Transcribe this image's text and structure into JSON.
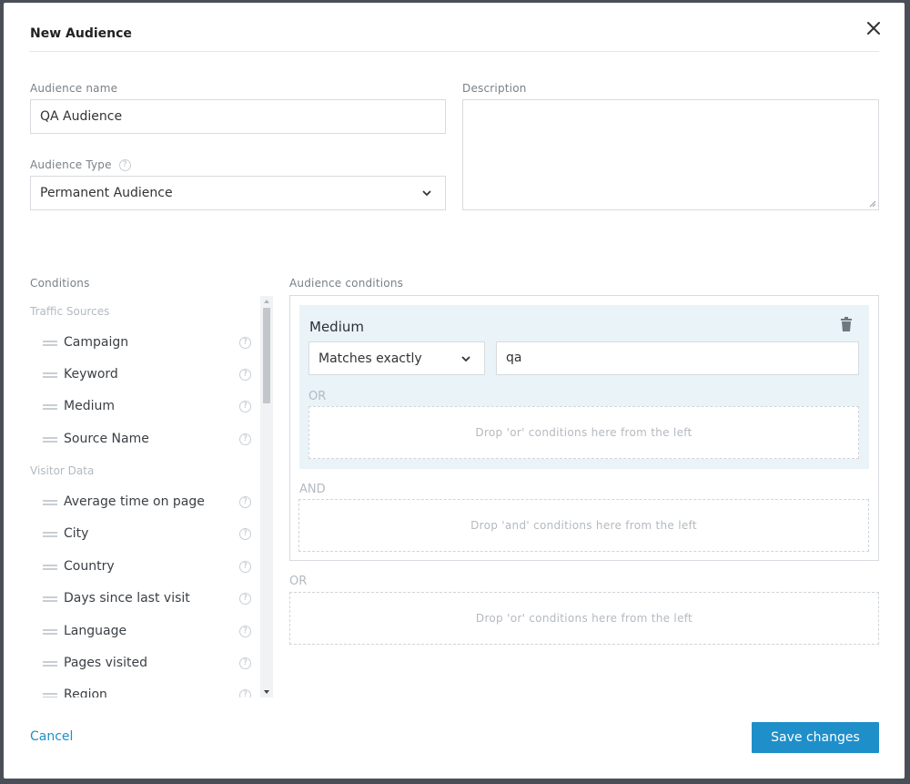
{
  "dialog": {
    "title": "New Audience",
    "close_icon": "close-icon"
  },
  "form": {
    "audience_name_label": "Audience name",
    "audience_name_value": "QA Audience",
    "audience_type_label": "Audience Type",
    "audience_type_value": "Permanent Audience",
    "description_label": "Description",
    "description_value": ""
  },
  "conditions": {
    "heading": "Conditions",
    "groups": [
      {
        "label": "Traffic Sources",
        "items": [
          "Campaign",
          "Keyword",
          "Medium",
          "Source Name"
        ]
      },
      {
        "label": "Visitor Data",
        "items": [
          "Average time on page",
          "City",
          "Country",
          "Days since last visit",
          "Language",
          "Pages visited",
          "Region"
        ]
      }
    ],
    "help_glyph": "?"
  },
  "audience_conditions": {
    "heading": "Audience conditions",
    "rule": {
      "title": "Medium",
      "operator": "Matches exactly",
      "value": "qa"
    },
    "or_label": "OR",
    "and_label": "AND",
    "drop_or": "Drop 'or' conditions here from the left",
    "drop_and": "Drop 'and' conditions here from the left"
  },
  "footer": {
    "cancel_label": "Cancel",
    "save_label": "Save changes"
  },
  "colors": {
    "accent": "#1f8fca",
    "rule_bg": "#e9f3f8"
  }
}
